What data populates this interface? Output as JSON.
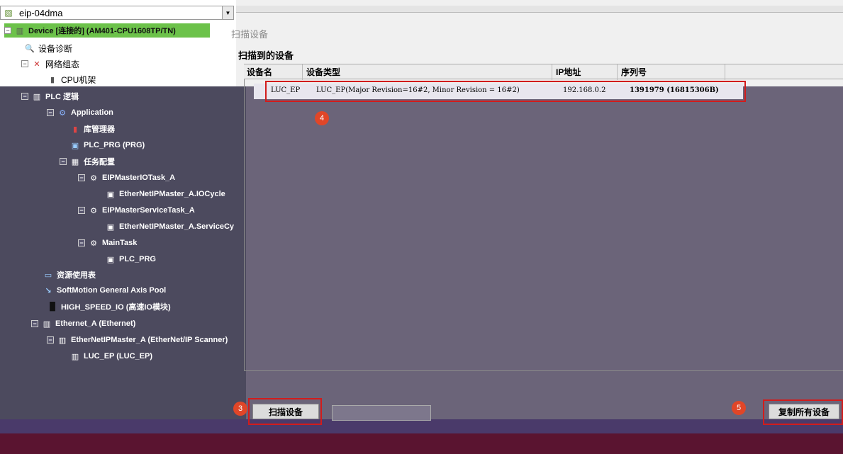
{
  "project": {
    "name": "eip-04dma"
  },
  "tree": {
    "device": "Device [连接的] (AM401-CPU1608TP/TN)",
    "items": [
      "设备诊断",
      "网络组态",
      "CPU机架",
      "PLC 逻辑",
      "Application",
      "库管理器",
      "PLC_PRG (PRG)",
      "任务配置",
      "EIPMasterIOTask_A",
      "EtherNetIPMaster_A.IOCycle",
      "EIPMasterServiceTask_A",
      "EtherNetIPMaster_A.ServiceCy",
      "MainTask",
      "PLC_PRG",
      "资源使用表",
      "SoftMotion General Axis Pool",
      "HIGH_SPEED_IO (高速IO模块)",
      "Ethernet_A (Ethernet)",
      "EtherNetIPMaster_A (EtherNet/IP Scanner)",
      "LUC_EP (LUC_EP)"
    ]
  },
  "dialog": {
    "title": "扫描设备",
    "group_label": "扫描到的设备",
    "columns": [
      "设备名",
      "设备类型",
      "IP地址",
      "序列号"
    ],
    "row": {
      "name": "LUC_EP",
      "type": "LUC_EP(Major Revision=16#2, Minor Revision = 16#2)",
      "ip": "192.168.0.2",
      "serial": "1391979 (16815306B)"
    },
    "scan_button": "扫描设备",
    "right_button": "复制所有设备"
  },
  "badges": {
    "b3": "3",
    "b4": "4",
    "b5": "5"
  }
}
